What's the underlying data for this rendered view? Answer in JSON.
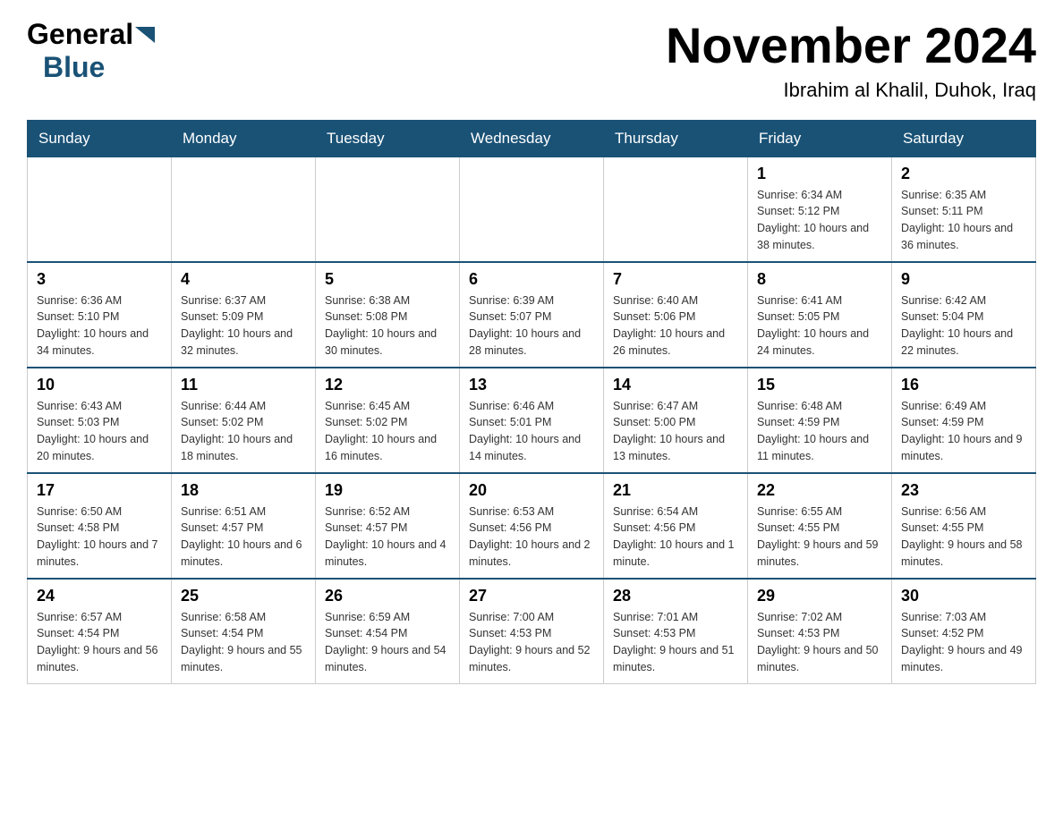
{
  "header": {
    "logo": {
      "general": "General",
      "blue": "Blue"
    },
    "title": "November 2024",
    "location": "Ibrahim al Khalil, Duhok, Iraq"
  },
  "weekdays": [
    "Sunday",
    "Monday",
    "Tuesday",
    "Wednesday",
    "Thursday",
    "Friday",
    "Saturday"
  ],
  "weeks": [
    [
      {
        "day": "",
        "info": ""
      },
      {
        "day": "",
        "info": ""
      },
      {
        "day": "",
        "info": ""
      },
      {
        "day": "",
        "info": ""
      },
      {
        "day": "",
        "info": ""
      },
      {
        "day": "1",
        "info": "Sunrise: 6:34 AM\nSunset: 5:12 PM\nDaylight: 10 hours and 38 minutes."
      },
      {
        "day": "2",
        "info": "Sunrise: 6:35 AM\nSunset: 5:11 PM\nDaylight: 10 hours and 36 minutes."
      }
    ],
    [
      {
        "day": "3",
        "info": "Sunrise: 6:36 AM\nSunset: 5:10 PM\nDaylight: 10 hours and 34 minutes."
      },
      {
        "day": "4",
        "info": "Sunrise: 6:37 AM\nSunset: 5:09 PM\nDaylight: 10 hours and 32 minutes."
      },
      {
        "day": "5",
        "info": "Sunrise: 6:38 AM\nSunset: 5:08 PM\nDaylight: 10 hours and 30 minutes."
      },
      {
        "day": "6",
        "info": "Sunrise: 6:39 AM\nSunset: 5:07 PM\nDaylight: 10 hours and 28 minutes."
      },
      {
        "day": "7",
        "info": "Sunrise: 6:40 AM\nSunset: 5:06 PM\nDaylight: 10 hours and 26 minutes."
      },
      {
        "day": "8",
        "info": "Sunrise: 6:41 AM\nSunset: 5:05 PM\nDaylight: 10 hours and 24 minutes."
      },
      {
        "day": "9",
        "info": "Sunrise: 6:42 AM\nSunset: 5:04 PM\nDaylight: 10 hours and 22 minutes."
      }
    ],
    [
      {
        "day": "10",
        "info": "Sunrise: 6:43 AM\nSunset: 5:03 PM\nDaylight: 10 hours and 20 minutes."
      },
      {
        "day": "11",
        "info": "Sunrise: 6:44 AM\nSunset: 5:02 PM\nDaylight: 10 hours and 18 minutes."
      },
      {
        "day": "12",
        "info": "Sunrise: 6:45 AM\nSunset: 5:02 PM\nDaylight: 10 hours and 16 minutes."
      },
      {
        "day": "13",
        "info": "Sunrise: 6:46 AM\nSunset: 5:01 PM\nDaylight: 10 hours and 14 minutes."
      },
      {
        "day": "14",
        "info": "Sunrise: 6:47 AM\nSunset: 5:00 PM\nDaylight: 10 hours and 13 minutes."
      },
      {
        "day": "15",
        "info": "Sunrise: 6:48 AM\nSunset: 4:59 PM\nDaylight: 10 hours and 11 minutes."
      },
      {
        "day": "16",
        "info": "Sunrise: 6:49 AM\nSunset: 4:59 PM\nDaylight: 10 hours and 9 minutes."
      }
    ],
    [
      {
        "day": "17",
        "info": "Sunrise: 6:50 AM\nSunset: 4:58 PM\nDaylight: 10 hours and 7 minutes."
      },
      {
        "day": "18",
        "info": "Sunrise: 6:51 AM\nSunset: 4:57 PM\nDaylight: 10 hours and 6 minutes."
      },
      {
        "day": "19",
        "info": "Sunrise: 6:52 AM\nSunset: 4:57 PM\nDaylight: 10 hours and 4 minutes."
      },
      {
        "day": "20",
        "info": "Sunrise: 6:53 AM\nSunset: 4:56 PM\nDaylight: 10 hours and 2 minutes."
      },
      {
        "day": "21",
        "info": "Sunrise: 6:54 AM\nSunset: 4:56 PM\nDaylight: 10 hours and 1 minute."
      },
      {
        "day": "22",
        "info": "Sunrise: 6:55 AM\nSunset: 4:55 PM\nDaylight: 9 hours and 59 minutes."
      },
      {
        "day": "23",
        "info": "Sunrise: 6:56 AM\nSunset: 4:55 PM\nDaylight: 9 hours and 58 minutes."
      }
    ],
    [
      {
        "day": "24",
        "info": "Sunrise: 6:57 AM\nSunset: 4:54 PM\nDaylight: 9 hours and 56 minutes."
      },
      {
        "day": "25",
        "info": "Sunrise: 6:58 AM\nSunset: 4:54 PM\nDaylight: 9 hours and 55 minutes."
      },
      {
        "day": "26",
        "info": "Sunrise: 6:59 AM\nSunset: 4:54 PM\nDaylight: 9 hours and 54 minutes."
      },
      {
        "day": "27",
        "info": "Sunrise: 7:00 AM\nSunset: 4:53 PM\nDaylight: 9 hours and 52 minutes."
      },
      {
        "day": "28",
        "info": "Sunrise: 7:01 AM\nSunset: 4:53 PM\nDaylight: 9 hours and 51 minutes."
      },
      {
        "day": "29",
        "info": "Sunrise: 7:02 AM\nSunset: 4:53 PM\nDaylight: 9 hours and 50 minutes."
      },
      {
        "day": "30",
        "info": "Sunrise: 7:03 AM\nSunset: 4:52 PM\nDaylight: 9 hours and 49 minutes."
      }
    ]
  ]
}
